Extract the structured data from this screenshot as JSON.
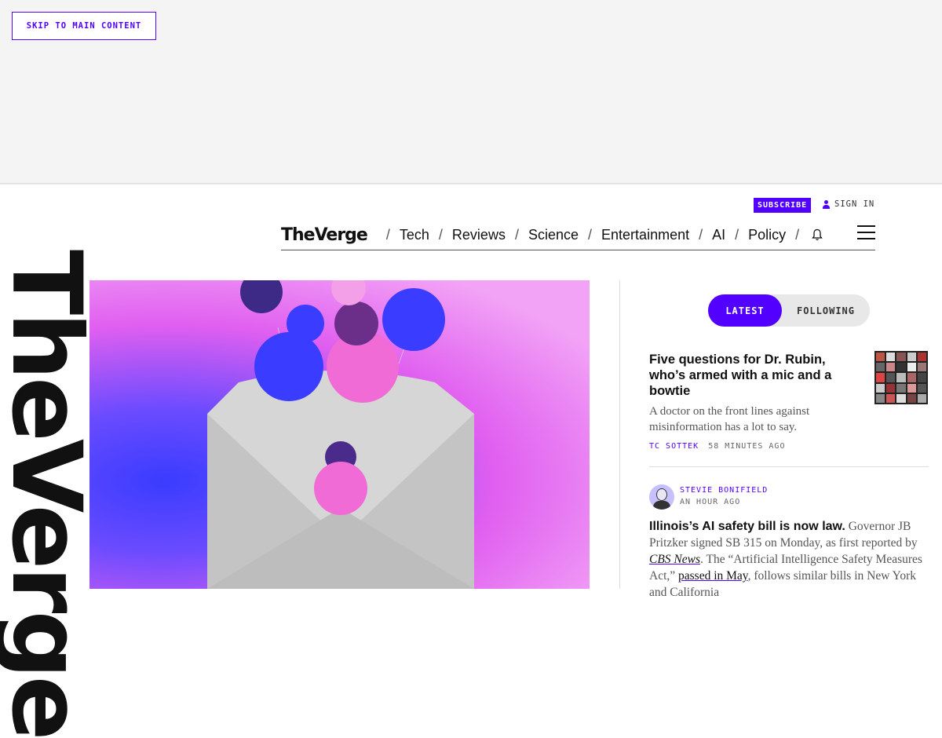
{
  "skip_link": "SKIP TO MAIN CONTENT",
  "header": {
    "subscribe": "SUBSCRIBE",
    "sign_in": "SIGN IN",
    "logo": "TheVerge",
    "nav": [
      "Tech",
      "Reviews",
      "Science",
      "Entertainment",
      "AI",
      "Policy"
    ],
    "separator": "/"
  },
  "vertical_logo": "TheVerge",
  "feed": {
    "tabs": {
      "latest": "LATEST",
      "following": "FOLLOWING"
    },
    "story1": {
      "title": "Five questions for Dr. Rubin, who’s armed with a mic and a bowtie",
      "dek": "A doctor on the front lines against misinformation has a lot to say.",
      "author": "TC SOTTEK",
      "time": "58 MINUTES AGO"
    },
    "story2": {
      "author": "STEVIE BONIFIELD",
      "time": "AN HOUR AGO",
      "headline": "Illinois’s AI safety bill is now law.",
      "text1": " Governor JB Pritzker signed SB 315 on Monday, as first reported by ",
      "link1": "CBS News",
      "text2": ". The “Artificial Intelligence Safety Measures Act,” ",
      "link2": "passed in May",
      "text3": ", follows similar bills in New York and California"
    }
  },
  "colors": {
    "accent": "#5200ff",
    "hero_pink": "#e05ff0",
    "hero_blue": "#3a3cff"
  }
}
